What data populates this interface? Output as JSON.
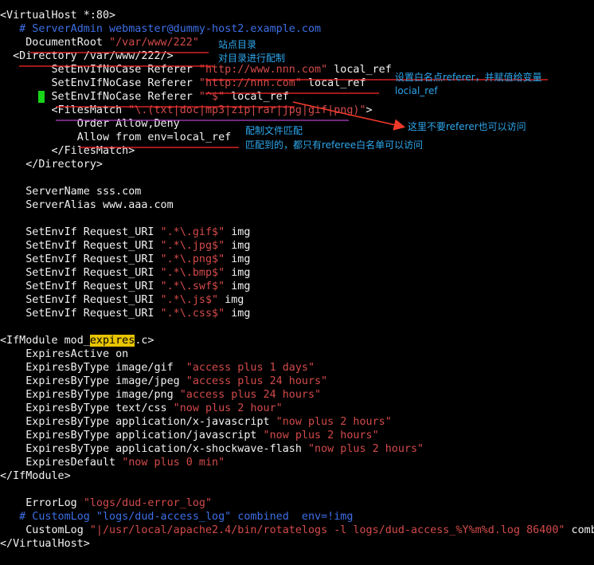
{
  "colors": {
    "background": "#000000",
    "text": "#f2f2f2",
    "string": "#d34a4a",
    "comment": "#3d6fe6",
    "highlight": "#e8c400",
    "cursor": "#18d418",
    "annotation_text": "#2ea8ee",
    "annotation_mark": "#ff2a2a",
    "arrow": "#f23a2a"
  },
  "config_lines": [
    [
      {
        "t": "<VirtualHost *:80>",
        "c": "w"
      }
    ],
    [
      {
        "t": "   # ServerAdmin webmaster@dummy-host2.example.com",
        "c": "c"
      }
    ],
    [
      {
        "t": "    DocumentRoot ",
        "c": "w"
      },
      {
        "t": "\"/var/www/222\"",
        "c": "s"
      }
    ],
    [
      {
        "t": "  <Directory /var/www/222/>",
        "c": "w"
      }
    ],
    [
      {
        "t": "        SetEnvIfNoCase Referer ",
        "c": "w"
      },
      {
        "t": "\"http://www.nnn.com\"",
        "c": "s"
      },
      {
        "t": " local_ref",
        "c": "w"
      }
    ],
    [
      {
        "t": "        SetEnvIfNoCase Referer ",
        "c": "w"
      },
      {
        "t": "\"http://nnn.com\"",
        "c": "s"
      },
      {
        "t": " local_ref",
        "c": "w"
      }
    ],
    [
      {
        "t": "      ",
        "c": "w"
      },
      {
        "t": " ",
        "c": "cursor"
      },
      {
        "t": " SetEnvIfNoCase Referer ",
        "c": "w"
      },
      {
        "t": "\"^$\"",
        "c": "s"
      },
      {
        "t": " local_ref",
        "c": "w"
      }
    ],
    [
      {
        "t": "        <FilesMatch ",
        "c": "w"
      },
      {
        "t": "\"\\.(txt|doc|mp3|zip|rar|jpg|gif|png)\"",
        "c": "s"
      },
      {
        "t": ">",
        "c": "w"
      }
    ],
    [
      {
        "t": "            Order Allow,Deny",
        "c": "w"
      }
    ],
    [
      {
        "t": "            Allow from env=local_ref",
        "c": "w"
      }
    ],
    [
      {
        "t": "        </FilesMatch>",
        "c": "w"
      }
    ],
    [
      {
        "t": "    </Directory>",
        "c": "w"
      }
    ],
    [
      {
        "t": "",
        "c": "w"
      }
    ],
    [
      {
        "t": "    ServerName sss.com",
        "c": "w"
      }
    ],
    [
      {
        "t": "    ServerAlias www.aaa.com",
        "c": "w"
      }
    ],
    [
      {
        "t": "",
        "c": "w"
      }
    ],
    [
      {
        "t": "    SetEnvIf Request_URI ",
        "c": "w"
      },
      {
        "t": "\".*\\.gif$\"",
        "c": "s"
      },
      {
        "t": " img",
        "c": "w"
      }
    ],
    [
      {
        "t": "    SetEnvIf Request_URI ",
        "c": "w"
      },
      {
        "t": "\".*\\.jpg$\"",
        "c": "s"
      },
      {
        "t": " img",
        "c": "w"
      }
    ],
    [
      {
        "t": "    SetEnvIf Request_URI ",
        "c": "w"
      },
      {
        "t": "\".*\\.png$\"",
        "c": "s"
      },
      {
        "t": " img",
        "c": "w"
      }
    ],
    [
      {
        "t": "    SetEnvIf Request_URI ",
        "c": "w"
      },
      {
        "t": "\".*\\.bmp$\"",
        "c": "s"
      },
      {
        "t": " img",
        "c": "w"
      }
    ],
    [
      {
        "t": "    SetEnvIf Request_URI ",
        "c": "w"
      },
      {
        "t": "\".*\\.swf$\"",
        "c": "s"
      },
      {
        "t": " img",
        "c": "w"
      }
    ],
    [
      {
        "t": "    SetEnvIf Request_URI ",
        "c": "w"
      },
      {
        "t": "\".*\\.js$\"",
        "c": "s"
      },
      {
        "t": " img",
        "c": "w"
      }
    ],
    [
      {
        "t": "    SetEnvIf Request_URI ",
        "c": "w"
      },
      {
        "t": "\".*\\.css$\"",
        "c": "s"
      },
      {
        "t": " img",
        "c": "w"
      }
    ],
    [
      {
        "t": "",
        "c": "w"
      }
    ],
    [
      {
        "t": "<IfModule mod_",
        "c": "w"
      },
      {
        "t": "expires",
        "c": "hl"
      },
      {
        "t": ".c>",
        "c": "w"
      }
    ],
    [
      {
        "t": "    ExpiresActive on",
        "c": "w"
      }
    ],
    [
      {
        "t": "    ExpiresByType image/gif  ",
        "c": "w"
      },
      {
        "t": "\"access plus 1 days\"",
        "c": "s"
      }
    ],
    [
      {
        "t": "    ExpiresByType image/jpeg ",
        "c": "w"
      },
      {
        "t": "\"access plus 24 hours\"",
        "c": "s"
      }
    ],
    [
      {
        "t": "    ExpiresByType image/png ",
        "c": "w"
      },
      {
        "t": "\"access plus 24 hours\"",
        "c": "s"
      }
    ],
    [
      {
        "t": "    ExpiresByType text/css ",
        "c": "w"
      },
      {
        "t": "\"now plus 2 hour\"",
        "c": "s"
      }
    ],
    [
      {
        "t": "    ExpiresByType application/x-javascript ",
        "c": "w"
      },
      {
        "t": "\"now plus 2 hours\"",
        "c": "s"
      }
    ],
    [
      {
        "t": "    ExpiresByType application/javascript ",
        "c": "w"
      },
      {
        "t": "\"now plus 2 hours\"",
        "c": "s"
      }
    ],
    [
      {
        "t": "    ExpiresByType application/x-shockwave-flash ",
        "c": "w"
      },
      {
        "t": "\"now plus 2 hours\"",
        "c": "s"
      }
    ],
    [
      {
        "t": "    ExpiresDefault ",
        "c": "w"
      },
      {
        "t": "\"now plus 0 min\"",
        "c": "s"
      }
    ],
    [
      {
        "t": "</IfModule>",
        "c": "w"
      }
    ],
    [
      {
        "t": "",
        "c": "w"
      }
    ],
    [
      {
        "t": "    ErrorLog ",
        "c": "w"
      },
      {
        "t": "\"logs/dud-error_log\"",
        "c": "s"
      }
    ],
    [
      {
        "t": "   # CustomLog \"logs/dud-access_log\" combined  env=!img",
        "c": "c"
      }
    ],
    [
      {
        "t": "    CustomLog ",
        "c": "w"
      },
      {
        "t": "\"|/usr/local/apache2.4/bin/rotatelogs -l logs/dud-access_%Y%m%d.log 86400\"",
        "c": "s"
      },
      {
        "t": " combined env=!img",
        "c": "w"
      }
    ],
    [
      {
        "t": "</VirtualHost>",
        "c": "w"
      }
    ]
  ],
  "annotations": {
    "site_dir": "站点目录",
    "dir_config": "对目录进行配制",
    "whitelist": "设置白名点referer，并赋值给变量",
    "var_name": "locial_ref",
    "no_referer": "这里不要referer也可以访问",
    "files_config": "配制文件匹配",
    "match_result": "匹配到的，都只有referee白名单可以访问"
  }
}
